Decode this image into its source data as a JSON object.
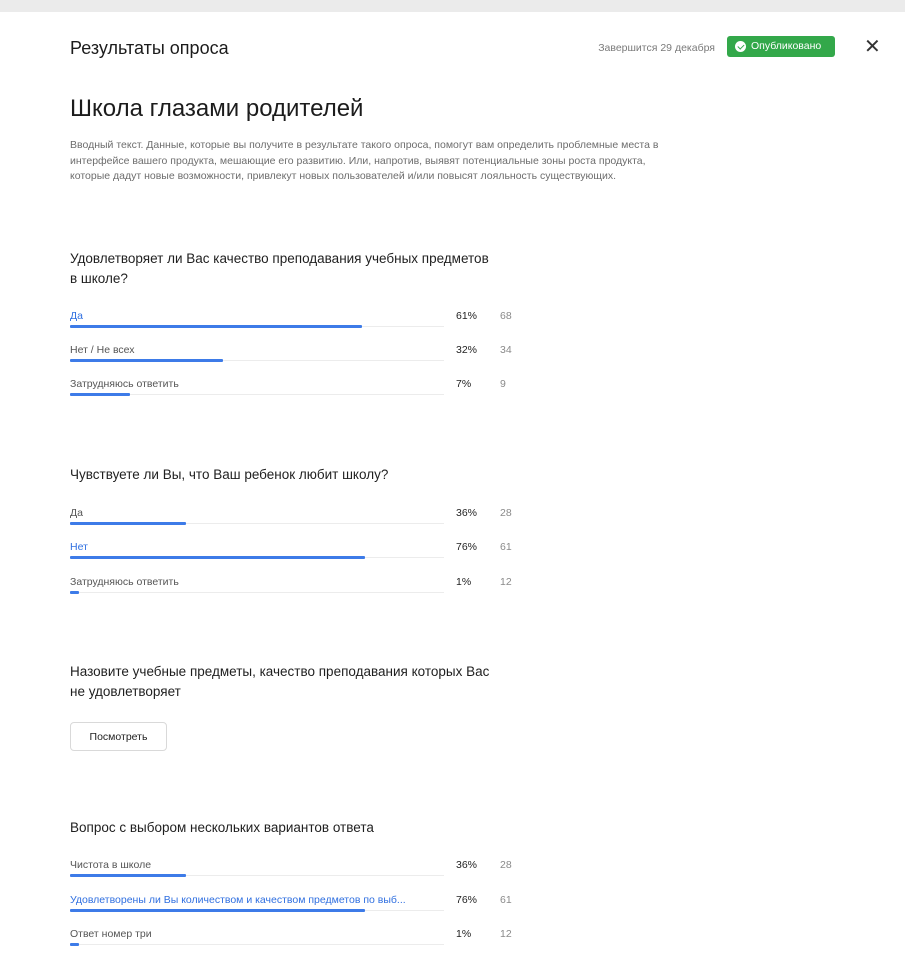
{
  "header": {
    "title": "Результаты опроса",
    "deadline": "Завершится 29 декабря",
    "status_badge": "Опубликовано",
    "status_color": "#33a84a",
    "close_icon": "✕"
  },
  "survey": {
    "title": "Школа глазами родителей",
    "intro": "Вводный текст. Данные, которые вы получите в результате такого опроса, помогут вам определить проблемные места в интерфейсе вашего продукта, мешающие его развитию. Или, напротив, выявят потенциальные зоны роста продукта, которые дадут новые возможности, привлекут новых пользователей и/или повысят лояльность существующих."
  },
  "accent_color": "#3d7be8",
  "questions": [
    {
      "text": "Удовлетворяет ли Вас качество преподавания учебных предметов в школе?",
      "options": [
        {
          "label": "Да",
          "percent": "61%",
          "count": "68",
          "fill": 0.78,
          "selected": true
        },
        {
          "label": "Нет / Не всех",
          "percent": "32%",
          "count": "34",
          "fill": 0.41,
          "selected": false
        },
        {
          "label": "Затрудняюсь ответить",
          "percent": "7%",
          "count": "9",
          "fill": 0.16,
          "selected": false
        }
      ]
    },
    {
      "text": "Чувствуете ли Вы, что Ваш ребенок любит школу?",
      "options": [
        {
          "label": "Да",
          "percent": "36%",
          "count": "28",
          "fill": 0.31,
          "selected": false
        },
        {
          "label": "Нет",
          "percent": "76%",
          "count": "61",
          "fill": 0.79,
          "selected": true
        },
        {
          "label": "Затрудняюсь ответить",
          "percent": "1%",
          "count": "12",
          "fill": 0.025,
          "selected": false
        }
      ]
    },
    {
      "text": "Назовите учебные предметы, качество преподавания которых Вас не удовлетворяет",
      "button_label": "Посмотреть"
    },
    {
      "text": "Вопрос с выбором нескольких вариантов ответа",
      "options": [
        {
          "label": "Чистота в школе",
          "percent": "36%",
          "count": "28",
          "fill": 0.31,
          "selected": false
        },
        {
          "label": "Удовлетворены ли Вы количеством и качеством предметов по выб...",
          "percent": "76%",
          "count": "61",
          "fill": 0.79,
          "selected": true
        },
        {
          "label": "Ответ номер три",
          "percent": "1%",
          "count": "12",
          "fill": 0.025,
          "selected": false
        }
      ]
    }
  ]
}
